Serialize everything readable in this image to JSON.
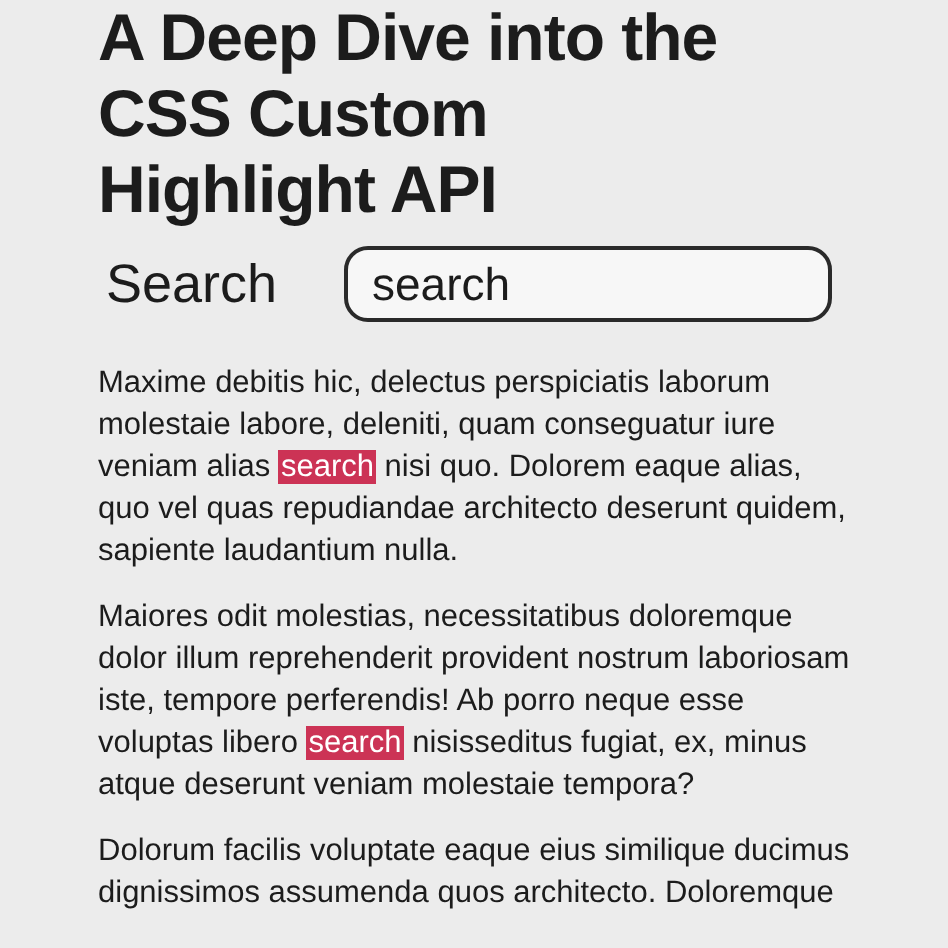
{
  "title": "A Deep Dive into the CSS Custom Highlight API",
  "search": {
    "label": "Search",
    "value": "search"
  },
  "paragraphs": [
    [
      {
        "text": "Maxime debitis hic, delectus perspiciatis laborum molestaie labore, deleniti, quam conseguatur iure veniam alias ",
        "highlighted": false
      },
      {
        "text": "search",
        "highlighted": true
      },
      {
        "text": " nisi quo. Dolorem eaque alias, quo vel quas repudiandae architecto deserunt quidem, sapiente laudantium nulla.",
        "highlighted": false
      }
    ],
    [
      {
        "text": "Maiores odit molestias, necessitatibus doloremque dolor illum reprehenderit provident nostrum laboriosam iste, tempore perferendis! Ab porro neque esse voluptas libero ",
        "highlighted": false
      },
      {
        "text": "search",
        "highlighted": true
      },
      {
        "text": " nisisseditus fugiat, ex, minus atque deserunt veniam molestaie tempora?",
        "highlighted": false
      }
    ],
    [
      {
        "text": "Dolorum facilis voluptate eaque eius similique ducimus dignissimos assumenda quos architecto. Doloremque",
        "highlighted": false
      }
    ]
  ]
}
